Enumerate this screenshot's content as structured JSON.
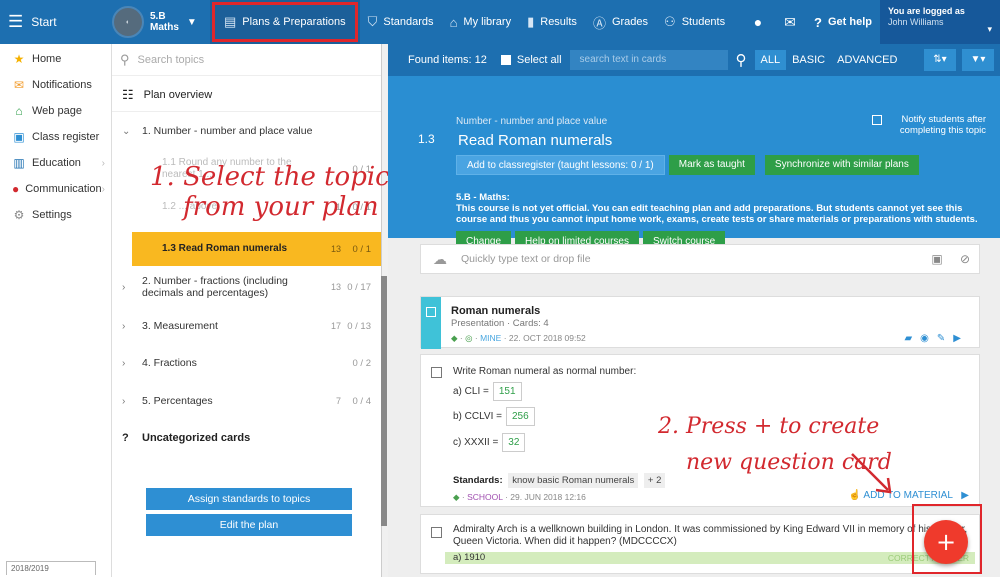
{
  "topbar": {
    "start_label": "Start",
    "course_name": "5.B",
    "course_subject": "Maths",
    "nav": [
      {
        "label": "Plans & Preparations",
        "icon": "plans-icon"
      },
      {
        "label": "Standards",
        "icon": "shield-icon"
      },
      {
        "label": "My library",
        "icon": "library-icon"
      },
      {
        "label": "Results",
        "icon": "bar-chart-icon"
      },
      {
        "label": "Grades",
        "icon": "grade-icon"
      },
      {
        "label": "Students",
        "icon": "students-icon"
      }
    ],
    "get_help": "Get help",
    "login_line1": "You are logged as",
    "login_line2": "John Williams"
  },
  "sidebar": {
    "items": [
      {
        "label": "Home",
        "icon": "star-icon"
      },
      {
        "label": "Notifications",
        "icon": "envelope-icon"
      },
      {
        "label": "Web page",
        "icon": "house-icon"
      },
      {
        "label": "Class register",
        "icon": "register-icon"
      },
      {
        "label": "Education",
        "icon": "education-icon"
      },
      {
        "label": "Communication",
        "icon": "chat-icon"
      },
      {
        "label": "Settings",
        "icon": "gear-icon"
      }
    ],
    "year": "2018/2019"
  },
  "topics": {
    "search_placeholder": "Search topics",
    "plan_overview": "Plan overview",
    "list": [
      {
        "name": "1. Number - number and place value",
        "c1": "",
        "c2": ""
      },
      {
        "name": "2. Number - fractions (including decimals and percentages)",
        "c1": "13",
        "c2": "0 / 17"
      },
      {
        "name": "3. Measurement",
        "c1": "17",
        "c2": "0 / 13"
      },
      {
        "name": "4. Fractions",
        "c1": "",
        "c2": "0 / 2"
      },
      {
        "name": "5. Percentages",
        "c1": "7",
        "c2": "0 / 4"
      }
    ],
    "subtopics": [
      {
        "name": "1.1 Round any number to the nearest 1...",
        "c1": "",
        "c2": "0 / 1"
      },
      {
        "name": "1.2 ... above",
        "c1": "1",
        "c2": "0 / 1"
      },
      {
        "name": "1.3 Read Roman numerals",
        "c1": "13",
        "c2": "0 / 1"
      }
    ],
    "uncategorized": "Uncategorized cards",
    "assign_btn": "Assign standards to topics",
    "edit_btn": "Edit the plan",
    "annotation": "1. Select the topic\n    from your plan"
  },
  "filterbar": {
    "found": "Found items: 12",
    "select_all": "Select all",
    "search_placeholder": "search text in cards",
    "filters": [
      "ALL",
      "BASIC",
      "ADVANCED"
    ]
  },
  "topic_header": {
    "number": "1.3",
    "category": "Number - number and place value",
    "title": "Read Roman numerals",
    "notify": "Notify students after completing this topic",
    "btn_add": "Add to classregister (taught lessons: 0 / 1)",
    "btn_mark": "Mark as taught",
    "btn_sync": "Synchronize with similar plans",
    "course_line": "5.B - Maths:",
    "course_notice": "This course is not yet official. You can edit teaching plan and add preparations. But students cannot yet see this course and thus you cannot input home work, exams, create tests or share materials or preparations with students.",
    "btn_change": "Change",
    "btn_help": "Help on limited courses",
    "btn_switch": "Switch course"
  },
  "quick_input": "Quickly type text or drop file",
  "presentation_card": {
    "title": "Roman numerals",
    "subtitle": "Presentation · Cards: 4",
    "owner": "MINE",
    "date": "22. OCT 2018 09:52"
  },
  "question_card": {
    "question": "Write Roman numeral as normal number:",
    "answers": [
      {
        "label": "a) CLI =",
        "value": "151"
      },
      {
        "label": "b) CCLVI =",
        "value": "256"
      },
      {
        "label": "c) XXXII =",
        "value": "32"
      }
    ],
    "standards_label": "Standards:",
    "standard": "know basic Roman numerals",
    "more": "+ 2",
    "owner": "SCHOOL",
    "date": "29. JUN 2018 12:16",
    "add_material": "ADD TO MATERIAL"
  },
  "question_card2": {
    "question": "Admiralty Arch is a wellknown building in London. It was commissioned by King Edward VII in memory of his mother, Queen Victoria. When did it happen? (MDCCCCX)",
    "answer": "a)  1910",
    "correct": "CORRECT ANSWER"
  },
  "annotation2": "2. Press + to create\n    new question card",
  "fab_label": "+",
  "colors": {
    "brand": "#1d6fb0",
    "accent": "#2a8ed2",
    "active_topic": "#f9b820",
    "fab": "#ef3a2c",
    "annotation": "#d2292f"
  }
}
